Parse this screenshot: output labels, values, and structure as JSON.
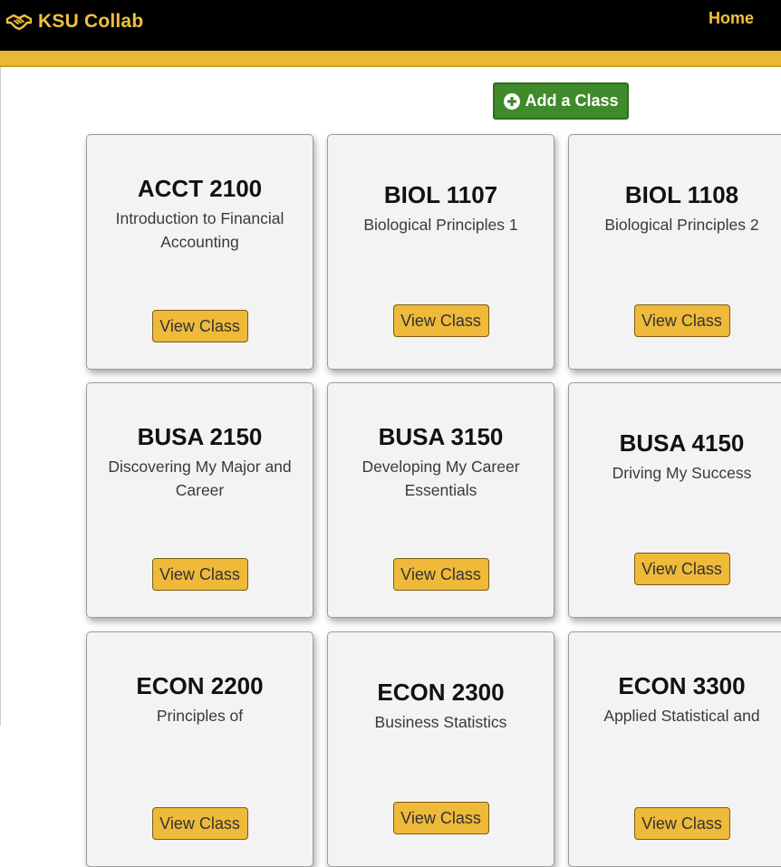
{
  "header": {
    "brand_name": "KSU Collab",
    "home_label": "Home"
  },
  "actions": {
    "add_class_label": "Add a Class"
  },
  "colors": {
    "header_bg": "#000000",
    "brand_gold": "#f2c03d",
    "gold_strip": "#e8b937",
    "add_button_green": "#3f8a2a",
    "view_button_gold": "#efb93a",
    "card_bg": "#f3f3f3"
  },
  "icons": {
    "brand": "handshake-icon",
    "add": "plus-circle-icon"
  },
  "classes": [
    {
      "code": "ACCT 2100",
      "title": "Introduction to Financial Accounting",
      "button": "View Class"
    },
    {
      "code": "BIOL 1107",
      "title": "Biological Principles 1",
      "button": "View Class"
    },
    {
      "code": "BIOL 1108",
      "title": "Biological Principles 2",
      "button": "View Class"
    },
    {
      "code": "BUSA 2150",
      "title": "Discovering My Major and Career",
      "button": "View Class"
    },
    {
      "code": "BUSA 3150",
      "title": "Developing My Career Essentials",
      "button": "View Class"
    },
    {
      "code": "BUSA 4150",
      "title": "Driving My Success",
      "button": "View Class"
    },
    {
      "code": "ECON 2200",
      "title": "Principles of",
      "button": "View Class"
    },
    {
      "code": "ECON 2300",
      "title": "Business Statistics",
      "button": "View Class"
    },
    {
      "code": "ECON 3300",
      "title": "Applied Statistical and",
      "button": "View Class"
    }
  ]
}
